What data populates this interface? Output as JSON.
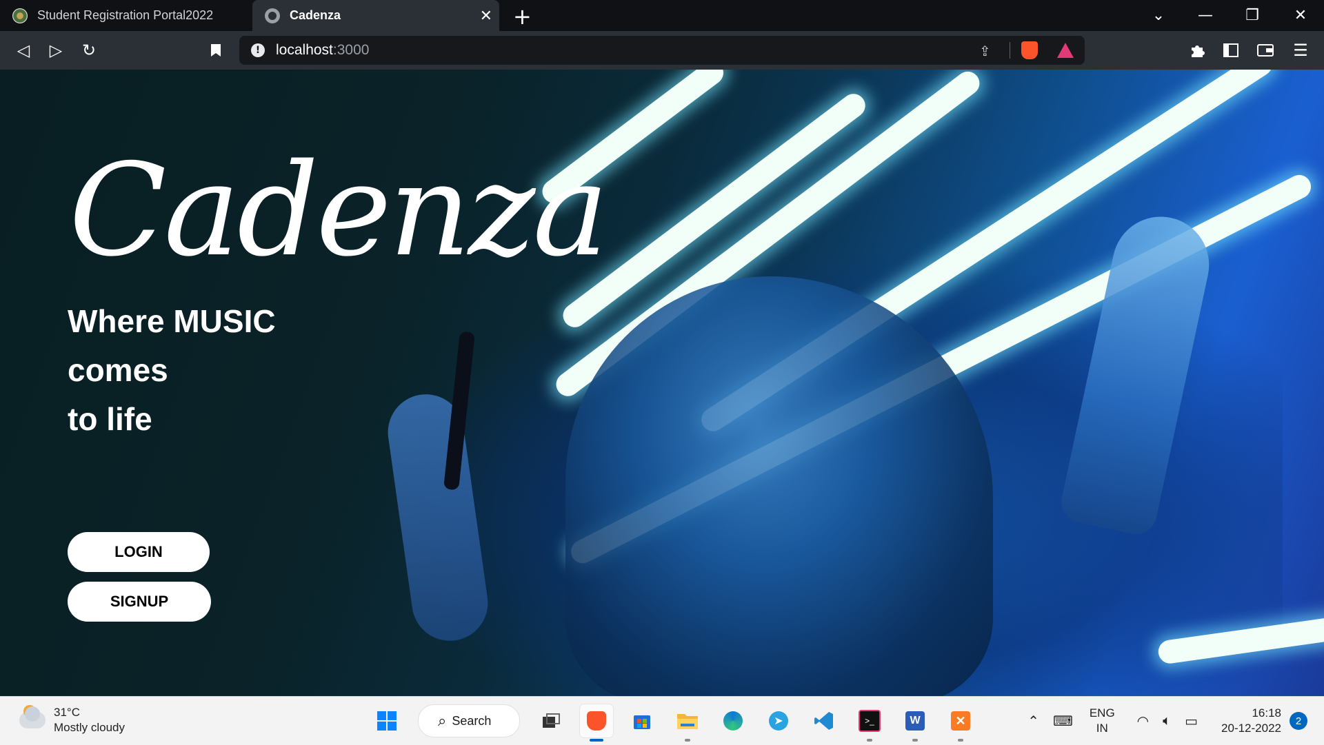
{
  "browser": {
    "tabs": [
      {
        "title": "Student Registration Portal2022",
        "active": false
      },
      {
        "title": "Cadenza",
        "active": true
      }
    ],
    "new_tab": "+",
    "address": {
      "host": "localhost",
      "port": ":3000"
    }
  },
  "page": {
    "logo": "Cadenza",
    "tagline": [
      "Where MUSIC",
      "comes",
      "to life"
    ],
    "login_label": "LOGIN",
    "signup_label": "SIGNUP"
  },
  "taskbar": {
    "weather": {
      "temp": "31°C",
      "condition": "Mostly cloudy"
    },
    "search_label": "Search",
    "language": {
      "code": "ENG",
      "region": "IN"
    },
    "time": "16:18",
    "date": "20-12-2022",
    "notifications": "2"
  },
  "colors": {
    "chrome_dark": "#0f1114",
    "toolbar": "#2b2f36",
    "hero_text": "#ffffff",
    "button_bg": "#ffffff",
    "taskbar_bg": "#f3f3f3",
    "accent": "#0067c0"
  },
  "icons": {
    "back": "back-arrow-icon",
    "forward": "forward-arrow-icon",
    "reload": "reload-icon",
    "bookmark": "bookmark-icon",
    "share": "share-icon",
    "extensions": "puzzle-icon",
    "sidebar": "sidebar-icon",
    "wallet": "wallet-icon",
    "menu": "hamburger-menu-icon"
  }
}
